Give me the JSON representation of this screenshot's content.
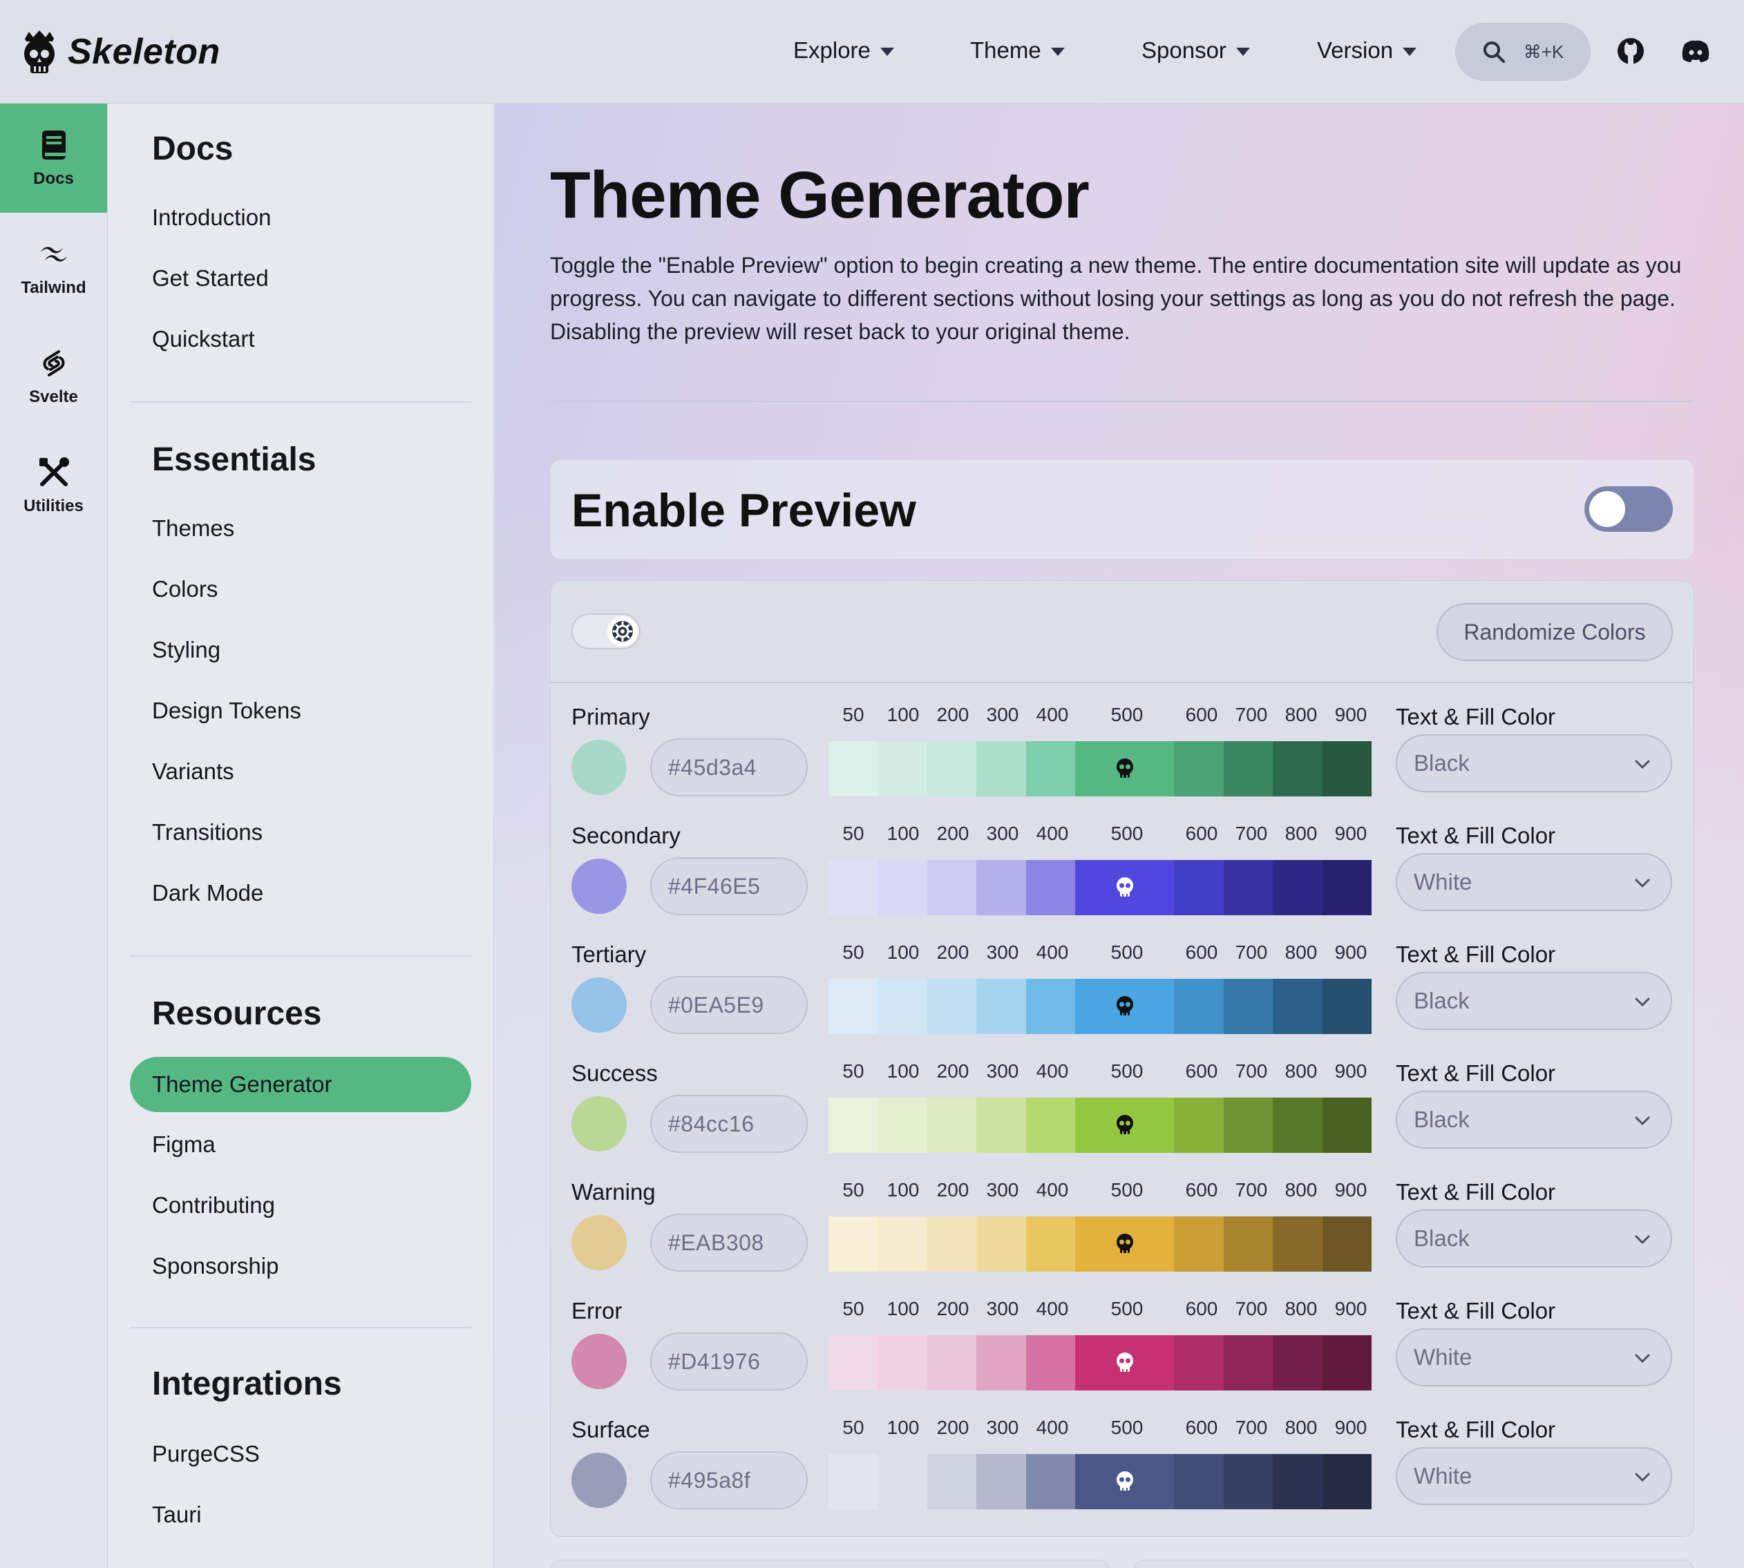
{
  "brand": {
    "name": "Skeleton"
  },
  "topnav": {
    "items": [
      {
        "label": "Explore"
      },
      {
        "label": "Theme"
      },
      {
        "label": "Sponsor"
      },
      {
        "label": "Version"
      }
    ],
    "search_shortcut": "⌘+K",
    "icons": [
      "search-icon",
      "github-icon",
      "discord-icon"
    ]
  },
  "rail": {
    "items": [
      {
        "label": "Docs",
        "icon": "book-icon",
        "active": true
      },
      {
        "label": "Tailwind",
        "icon": "tailwind-icon"
      },
      {
        "label": "Svelte",
        "icon": "svelte-icon"
      },
      {
        "label": "Utilities",
        "icon": "tools-icon"
      }
    ]
  },
  "sidebar": {
    "sections": [
      {
        "title": "Docs",
        "links": [
          "Introduction",
          "Get Started",
          "Quickstart"
        ]
      },
      {
        "title": "Essentials",
        "links": [
          "Themes",
          "Colors",
          "Styling",
          "Design Tokens",
          "Variants",
          "Transitions",
          "Dark Mode"
        ]
      },
      {
        "title": "Resources",
        "links": [
          "Theme Generator",
          "Figma",
          "Contributing",
          "Sponsorship"
        ],
        "active": "Theme Generator"
      },
      {
        "title": "Integrations",
        "links": [
          "PurgeCSS",
          "Tauri"
        ]
      }
    ]
  },
  "page": {
    "title": "Theme Generator",
    "description": "Toggle the \"Enable Preview\" option to begin creating a new theme. The entire documentation site will update as you progress. You can navigate to different sections without losing your settings as long as you do not refresh the page. Disabling the preview will reset back to your original theme."
  },
  "preview": {
    "title": "Enable Preview",
    "enabled": false
  },
  "generator": {
    "randomize_label": "Randomize Colors",
    "shade_labels": [
      "50",
      "100",
      "200",
      "300",
      "400",
      "500",
      "600",
      "700",
      "800",
      "900"
    ],
    "fill_label": "Text & Fill Color",
    "rows": [
      {
        "name": "Primary",
        "hex": "#45d3a4",
        "fill": "Black",
        "dot": "#a8d9c8",
        "shades": [
          "#dbf1ea",
          "#d3ede5",
          "#c6e9dd",
          "#a9dfcb",
          "#7dcfac",
          "#55b882",
          "#4aa275",
          "#3a8661",
          "#2e6b4e",
          "#27573f"
        ],
        "skull": "#111111"
      },
      {
        "name": "Secondary",
        "hex": "#4F46E5",
        "fill": "White",
        "dot": "#9a96e6",
        "shades": [
          "#e0e0f5",
          "#d9d8f4",
          "#cccaf2",
          "#b3b0ec",
          "#8c85e6",
          "#5048de",
          "#433ec8",
          "#3833a4",
          "#2d2984",
          "#262270"
        ],
        "skull": "#ffffff"
      },
      {
        "name": "Tertiary",
        "hex": "#0EA5E9",
        "fill": "Black",
        "dot": "#96c3e8",
        "shades": [
          "#dbeaf5",
          "#d1e6f5",
          "#c2e0f4",
          "#a5d4ef",
          "#72bbe9",
          "#4aa5e3",
          "#3f92cc",
          "#3479a8",
          "#2b6188",
          "#245070"
        ],
        "skull": "#111111"
      },
      {
        "name": "Success",
        "hex": "#84cc16",
        "fill": "Black",
        "dot": "#bad795",
        "shades": [
          "#eaf2d9",
          "#e4efd0",
          "#dcebc1",
          "#cde3a1",
          "#b3d96f",
          "#94c640",
          "#86b23a",
          "#6f9431",
          "#587728",
          "#496222"
        ],
        "skull": "#111111"
      },
      {
        "name": "Warning",
        "hex": "#EAB308",
        "fill": "Black",
        "dot": "#e3cc92",
        "shades": [
          "#f7efd8",
          "#f6ecd0",
          "#f4e5bd",
          "#efd99c",
          "#e8c660",
          "#e2b23c",
          "#cc9f36",
          "#a8842f",
          "#876a28",
          "#6e5722"
        ],
        "skull": "#111111"
      },
      {
        "name": "Error",
        "hex": "#D41976",
        "fill": "White",
        "dot": "#d388ae",
        "shades": [
          "#f2dbe8",
          "#efd2e2",
          "#ebc6da",
          "#e2a6c5",
          "#d572a3",
          "#c73173",
          "#ae2c68",
          "#902558",
          "#741f48",
          "#5f1a3c"
        ],
        "skull": "#ffffff"
      },
      {
        "name": "Surface",
        "hex": "#495a8f",
        "fill": "White",
        "dot": "#989eba",
        "shades": [
          "#e4e6ef",
          "#dcdee8",
          "#d0d3e0",
          "#b5b9ce",
          "#8189ac",
          "#4a5787",
          "#414c78",
          "#363f64",
          "#2c3351",
          "#252a43"
        ],
        "skull": "#ffffff"
      }
    ]
  }
}
